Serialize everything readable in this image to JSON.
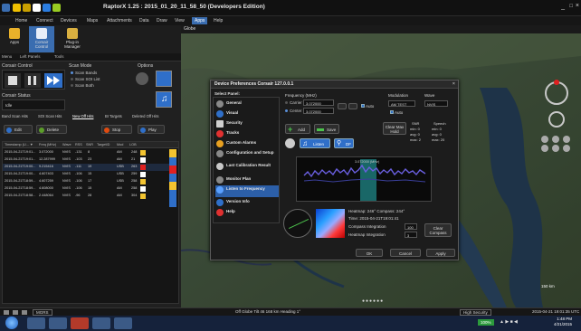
{
  "app": {
    "title": "RaptorX 1.25 : 2015_01_20_11_58_50 (Developers Edition)",
    "window_controls": [
      "_",
      "□",
      "×"
    ]
  },
  "menu": [
    "Home",
    "Connect",
    "Devices",
    "Maps",
    "Attachments",
    "Data",
    "Draw",
    "View",
    "Apps",
    "Help"
  ],
  "menu_active": "Apps",
  "ribbon": {
    "buttons": [
      "Apps",
      "Corsair Control",
      "Plug-in Manager"
    ],
    "sub": [
      "Menu",
      "Left Panels",
      "Tools"
    ]
  },
  "left": {
    "corsair_control": "Corsair Control",
    "scan_mode": "Scan Mode",
    "scan_options": [
      "Scan Bands",
      "Scan SOI List",
      "Scan Both"
    ],
    "options": "Options",
    "corsair_status": "Corsair Status",
    "idle": "Idle",
    "tabs": [
      "Band Scan Hits",
      "SOI Scan Hits",
      "New Off Hits",
      "BI Targets",
      "Deleted Off Hits"
    ],
    "buttons": [
      "Edit",
      "Delete",
      "Stop",
      "Play"
    ],
    "columns": [
      "Timestamp (U... ▼",
      "Freq (MHz)",
      "Wave",
      "RSS",
      "SNR",
      "TargetID",
      "Mod",
      "LOB"
    ],
    "rows": [
      [
        "2015-04-21T19:01...",
        "3.072000",
        "NVIS",
        "-131",
        "8",
        "",
        "AM",
        "248"
      ],
      [
        "2015-04-21T19:01...",
        "12.287999",
        "NVIS",
        "-103",
        "23",
        "",
        "AM",
        "21"
      ],
      [
        "2015-04-21T19:00...",
        "9.215416",
        "NVIS",
        "-111",
        "19",
        "",
        "USB",
        "263"
      ],
      [
        "2015-04-21T19:00...",
        "4.607403",
        "NVIS",
        "-106",
        "15",
        "",
        "USB",
        "259"
      ],
      [
        "2015-04-21T18:59...",
        "4.607259",
        "NVIS",
        "-106",
        "17",
        "",
        "USB",
        "258"
      ],
      [
        "2015-04-21T18:59...",
        "4.608000",
        "NVIS",
        "-106",
        "15",
        "",
        "AM",
        "258"
      ],
      [
        "2015-04-21T18:58...",
        "2.448064",
        "NVIS",
        "-96",
        "28",
        "",
        "AM",
        "304"
      ]
    ]
  },
  "map": {
    "tab": "Globe",
    "footer": "Off Globe  Tilt 46  168 km  Heading 1°",
    "scale": "150 km"
  },
  "dialog": {
    "title": "Device Preferences  Corsair 127.0.0.1",
    "select_panel": "Select Panel:",
    "panels": [
      "General",
      "Visual",
      "Security",
      "Tracks",
      "Custom Alarms",
      "Configuration and Setup",
      "Last Calibration Result",
      "Monitor Plan",
      "Listen to Frequency",
      "Version Info",
      "Help"
    ],
    "selected_panel": "Listen to Frequency",
    "frequency_label": "Frequency (MHz)",
    "carrier_label": "Carrier",
    "carrier_value": "3.072000",
    "center_label": "Center",
    "center_value": "3.072000",
    "auto": "Auto",
    "modulation_label": "Modulation",
    "modulation_value": "AM TEST",
    "wave_label": "Wave",
    "wave_value": "NVIS",
    "clear_max_hold": "Clear Max Hold",
    "snr_label": "SNR",
    "speech_label": "Speech",
    "snr_rows": [
      [
        "min: 0",
        "min: 0"
      ],
      [
        "avg: 0",
        "avg: 0"
      ],
      [
        "max: 2",
        "max: 20"
      ]
    ],
    "add": "Add",
    "save": "Save",
    "listen": "Listen",
    "df": "DF",
    "spectrum_label": "3.072000 (MHz)",
    "heatmap_line1": "Heatmap: 246°  Compass: 244°",
    "heatmap_time": "Time: 2015-04-21T19:01:41",
    "compass_integration": "Compass Integration",
    "compass_val": "100",
    "heatmap_integration": "Heatmap Integration",
    "heatmap_val": "3",
    "clear_compass": "Clear Compass",
    "ok": "OK",
    "cancel": "Cancel",
    "apply": "Apply"
  },
  "status": {
    "left": "MGRS",
    "right_mode": "High Security",
    "right_time": "2015-04-21 19:01:35 UTC",
    "zoom": "100%",
    "clock": "1:48 PM",
    "date": "4/21/2015"
  },
  "colors": {
    "accent": "#2c5fa8",
    "spectrum": "#4a3fb5",
    "heat_hi": "#ff2a2a"
  }
}
